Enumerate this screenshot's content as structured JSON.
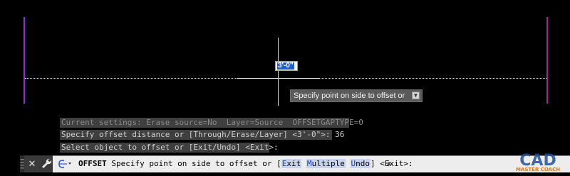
{
  "canvas": {
    "accent_colors": {
      "left_line": "#8a32e6",
      "right_line": "#b0229a",
      "selection": "#1f5fd1"
    }
  },
  "dynamic_input": {
    "value": "3'-0\""
  },
  "tooltip": {
    "text": "Specify point on side to offset or",
    "button_icon": "dropdown-icon"
  },
  "history": [
    "Current settings: Erase source=No  Layer=Source  OFFSETGAPTYPE=0",
    "Specify offset distance or [Through/Erase/Layer] <3'-0\">: 36",
    "Select object to offset or [Exit/Undo] <Exit>:"
  ],
  "command_line": {
    "command": "OFFSET",
    "prompt": " Specify point on side to offset or [",
    "options": [
      {
        "key": "E",
        "rest": "xit"
      },
      {
        "key": "M",
        "rest": "ultiple"
      },
      {
        "key": "U",
        "rest": "ndo"
      }
    ],
    "suffix": "] <Exit>:",
    "icons": [
      "close-icon",
      "wrench-icon",
      "command-prompt-icon",
      "dropdown-arrow-icon"
    ]
  },
  "watermark": {
    "line1": "CAD",
    "line2": "MASTER COACH"
  }
}
